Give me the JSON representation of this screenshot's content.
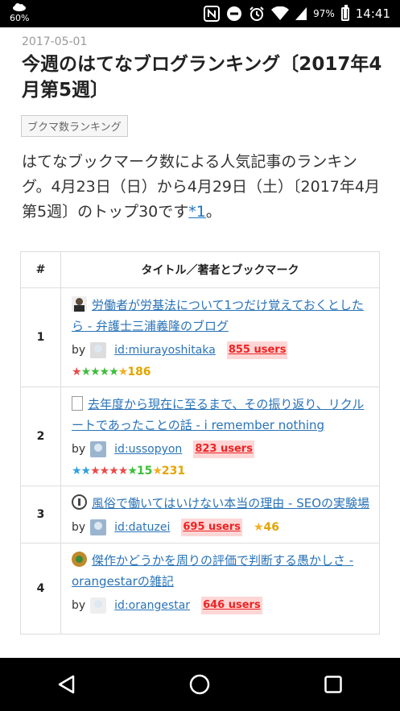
{
  "status_bar": {
    "weather_percent": "60%",
    "battery_percent": "97%",
    "time": "14:41",
    "icons": [
      "cloud-rain-icon",
      "nfc-icon",
      "do-not-disturb-icon",
      "alarm-icon",
      "wifi-icon",
      "signal-icon",
      "battery-icon"
    ]
  },
  "article": {
    "date": "2017-05-01",
    "title": "今週のはてなブログランキング〔2017年4月第5週〕",
    "tag": "ブクマ数ランキング",
    "desc_main": "はてなブックマーク数による人気記事のランキング。4月23日（日）から4月29日（土）〔2017年4月第5週〕のトップ30です",
    "desc_footnote": "*1",
    "desc_end": "。"
  },
  "table": {
    "headers": [
      "#",
      "タイトル／著者とブックマーク"
    ],
    "rows": [
      {
        "rank": "1",
        "title": "労働者が労基法について1つだけ覚えておくとしたら - 弁護士三浦義隆のブログ",
        "by": "by",
        "user": "id:miurayoshitaka",
        "users": "855 users",
        "star_count": "186",
        "icon_color": "#5b4a3a"
      },
      {
        "rank": "2",
        "title": "去年度から現在に至るまで、その振り返り、リクルートであったことの話 - i remember nothing",
        "by": "by",
        "user": "id:ussopyon",
        "users": "823 users",
        "green_count": "15",
        "star_count": "231",
        "icon_color": "#ffffff"
      },
      {
        "rank": "3",
        "title": "風俗で働いてはいけない本当の理由 - SEOの実験場",
        "by": "by",
        "user": "id:datuzei",
        "users": "695 users",
        "star_count": "46",
        "icon_color": "#444444"
      },
      {
        "rank": "4",
        "title": "傑作かどうかを周りの評価で判断する愚かしさ - orangestarの雑記",
        "by": "by",
        "user": "id:orangestar",
        "users": "646 users",
        "icon_color": "#c0892a"
      }
    ]
  },
  "nav": {
    "icons": [
      "back-icon",
      "home-icon",
      "recents-icon"
    ]
  }
}
